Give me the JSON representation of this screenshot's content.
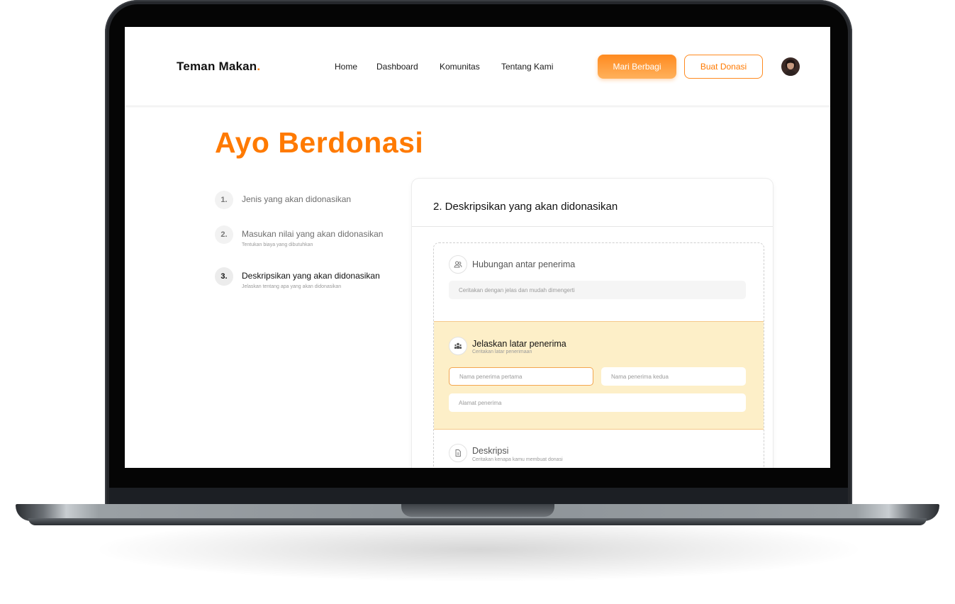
{
  "brand": {
    "name": "Teman Makan",
    "dot": "."
  },
  "nav": {
    "links": [
      "Home",
      "Dashboard",
      "Komunitas",
      "Tentang Kami"
    ],
    "primary_button": "Mari Berbagi",
    "secondary_button": "Buat Donasi"
  },
  "page": {
    "title": "Ayo Berdonasi"
  },
  "steps": [
    {
      "number": "1.",
      "label": "Jenis yang akan didonasikan",
      "sub": ""
    },
    {
      "number": "2.",
      "label": "Masukan nilai yang akan didonasikan",
      "sub": "Tentukan biaya yang dibutuhkan"
    },
    {
      "number": "3.",
      "label": "Deskripsikan yang akan didonasikan",
      "sub": "Jelaskan tentang apa yang  akan didonasikan"
    }
  ],
  "form": {
    "title": "2. Deskripsikan yang akan didonasikan",
    "sections": {
      "relation": {
        "title": "Hubungan antar penerima",
        "input_placeholder": "Ceritakan dengan jelas dan mudah dimengerti",
        "icon": "users-icon"
      },
      "background": {
        "title": "Jelaskan latar penerima",
        "subtitle": "Ceritakan latar penerimaan",
        "icon": "people-group-icon",
        "first_name_placeholder": "Nama penerima pertama",
        "second_name_placeholder": "Nama penerima kedua",
        "address_placeholder": "Alamat penerima"
      },
      "description": {
        "title": "Deskripsi",
        "subtitle": "Ceritakan kenapa kamu membuat donasi",
        "icon": "document-icon"
      }
    }
  },
  "colors": {
    "accent": "#ff7a00",
    "highlight": "#fdefc8"
  }
}
